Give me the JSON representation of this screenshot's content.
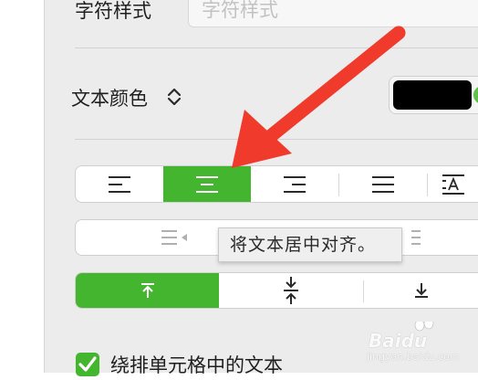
{
  "character_style": {
    "label": "字符样式",
    "placeholder": "字符样式"
  },
  "text_color": {
    "label": "文本颜色",
    "swatch_color": "#000000"
  },
  "alignment": {
    "buttons": [
      {
        "name": "align-left",
        "active": false
      },
      {
        "name": "align-center",
        "active": true
      },
      {
        "name": "align-right",
        "active": false
      },
      {
        "name": "align-justify",
        "active": false
      },
      {
        "name": "align-auto",
        "active": false
      }
    ]
  },
  "tooltip": {
    "text": "将文本居中对齐。"
  },
  "vertical_alignment": {
    "buttons": [
      {
        "name": "align-top",
        "active": true
      },
      {
        "name": "align-middle",
        "active": false
      },
      {
        "name": "align-bottom",
        "active": false
      }
    ]
  },
  "wrap_text": {
    "label": "绕排单元格中的文本",
    "checked": true
  },
  "watermark": {
    "brand": "Baidu",
    "sub": "jingyan.baidu.com"
  },
  "colors": {
    "accent": "#44b52f",
    "arrow": "#f03a2c"
  }
}
